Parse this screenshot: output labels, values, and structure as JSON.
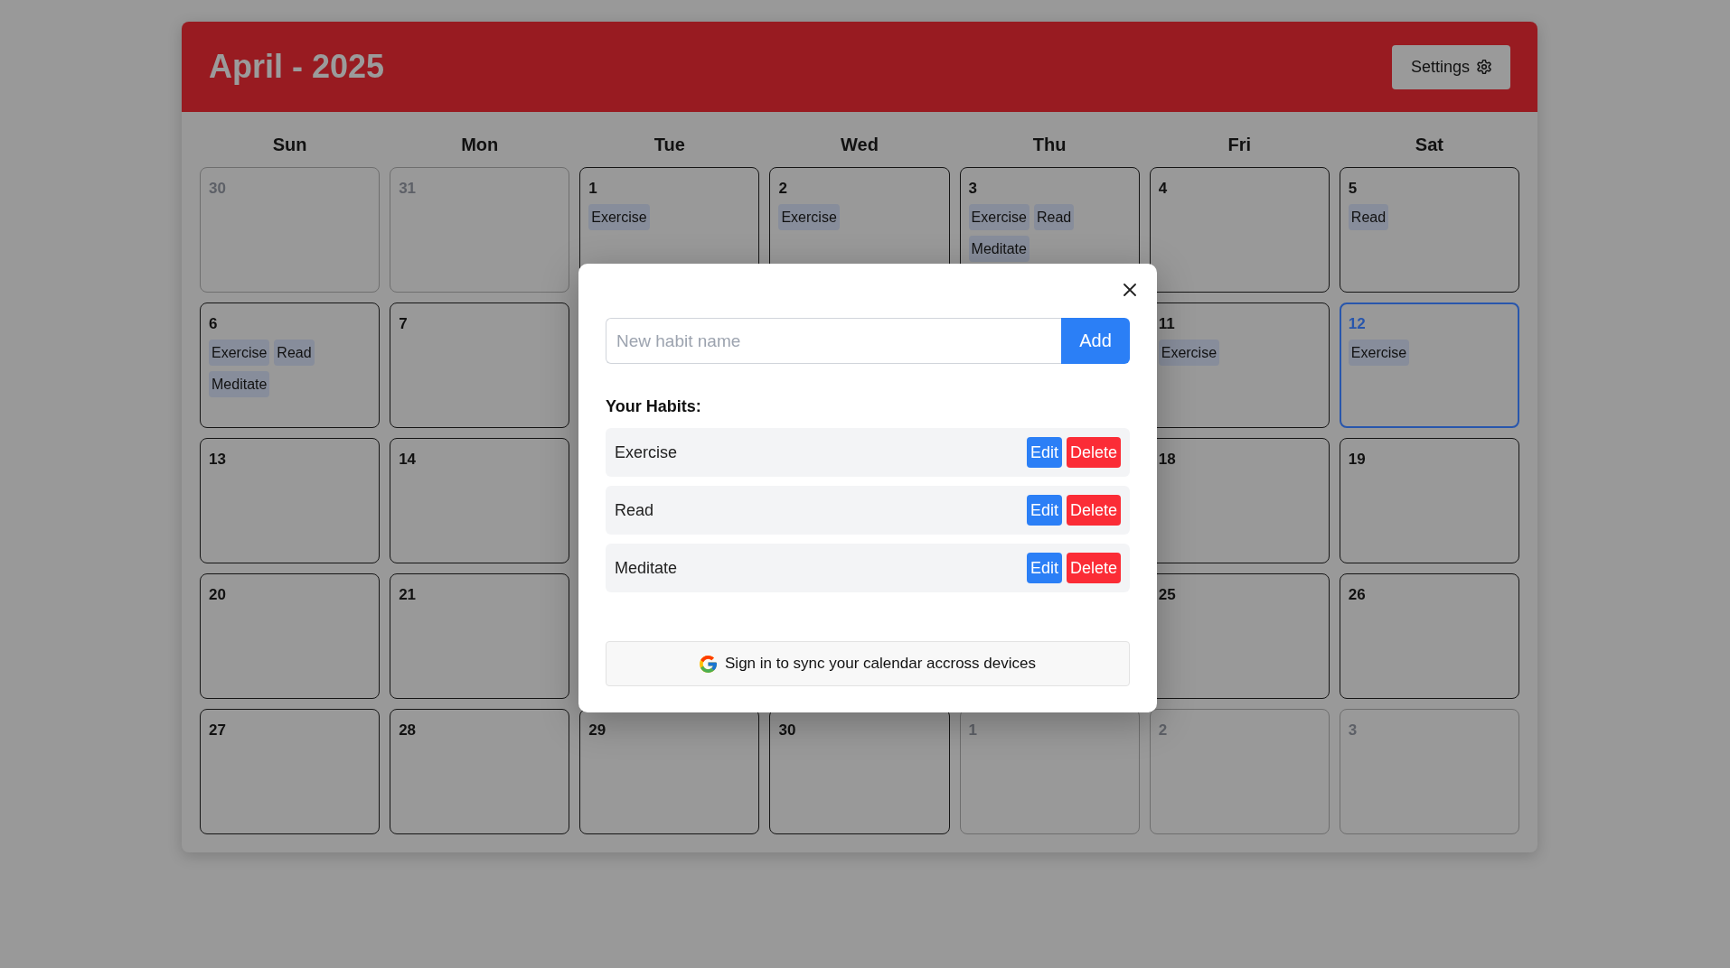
{
  "header": {
    "title": "April - 2025",
    "settings_button": "Settings"
  },
  "weekdays": [
    "Sun",
    "Mon",
    "Tue",
    "Wed",
    "Thu",
    "Fri",
    "Sat"
  ],
  "weeks": [
    {
      "days": [
        {
          "label": "30",
          "in_month": false,
          "today": false
        },
        {
          "label": "31",
          "in_month": false,
          "today": false
        },
        {
          "label": "1",
          "in_month": true,
          "today": false,
          "habits": [
            "Exercise"
          ]
        },
        {
          "label": "2",
          "in_month": true,
          "today": false,
          "habits": [
            "Exercise"
          ]
        },
        {
          "label": "3",
          "in_month": true,
          "today": false,
          "habits": [
            "Exercise",
            "Read",
            "Meditate"
          ]
        },
        {
          "label": "4",
          "in_month": true,
          "today": false
        },
        {
          "label": "5",
          "in_month": true,
          "today": false,
          "habits": [
            "Read"
          ]
        }
      ]
    },
    {
      "days": [
        {
          "label": "6",
          "in_month": true,
          "today": false,
          "habits": [
            "Exercise",
            "Read",
            "Meditate"
          ]
        },
        {
          "label": "7",
          "in_month": true,
          "today": false
        }
      ],
      "days_right": [
        {
          "label": "11",
          "in_month": true,
          "today": false,
          "habits": [
            "Exercise"
          ]
        },
        {
          "label": "12",
          "in_month": true,
          "today": true,
          "habits": [
            "Exercise"
          ]
        }
      ]
    },
    {
      "days": [
        {
          "label": "13",
          "in_month": true,
          "today": false
        },
        {
          "label": "14",
          "in_month": true,
          "today": false
        }
      ],
      "days_right": [
        {
          "label": "18",
          "in_month": true,
          "today": false
        },
        {
          "label": "19",
          "in_month": true,
          "today": false
        }
      ]
    },
    {
      "days": [
        {
          "label": "20",
          "in_month": true,
          "today": false
        },
        {
          "label": "21",
          "in_month": true,
          "today": false
        }
      ],
      "days_right": [
        {
          "label": "25",
          "in_month": true,
          "today": false
        },
        {
          "label": "26",
          "in_month": true,
          "today": false
        }
      ]
    },
    {
      "days": [
        {
          "label": "27",
          "in_month": true,
          "today": false
        },
        {
          "label": "28",
          "in_month": true,
          "today": false
        },
        {
          "label": "29",
          "in_month": true,
          "today": false
        },
        {
          "label": "30",
          "in_month": true,
          "today": false
        },
        {
          "label": "1",
          "in_month": false,
          "today": false
        },
        {
          "label": "2",
          "in_month": false,
          "today": false
        },
        {
          "label": "3",
          "in_month": false,
          "today": false
        }
      ]
    }
  ],
  "modal": {
    "input": {
      "placeholder": "New habit name"
    },
    "add_button": "Add",
    "habits_heading": "Your Habits:",
    "habits": [
      {
        "name": "Exercise",
        "edit_button": "Edit",
        "delete_button": "Delete"
      },
      {
        "name": "Read",
        "edit_button": "Edit",
        "delete_button": "Delete"
      },
      {
        "name": "Meditate",
        "edit_button": "Edit",
        "delete_button": "Delete"
      }
    ],
    "sign_in_button": "Sign in to sync your calendar accross devices"
  }
}
